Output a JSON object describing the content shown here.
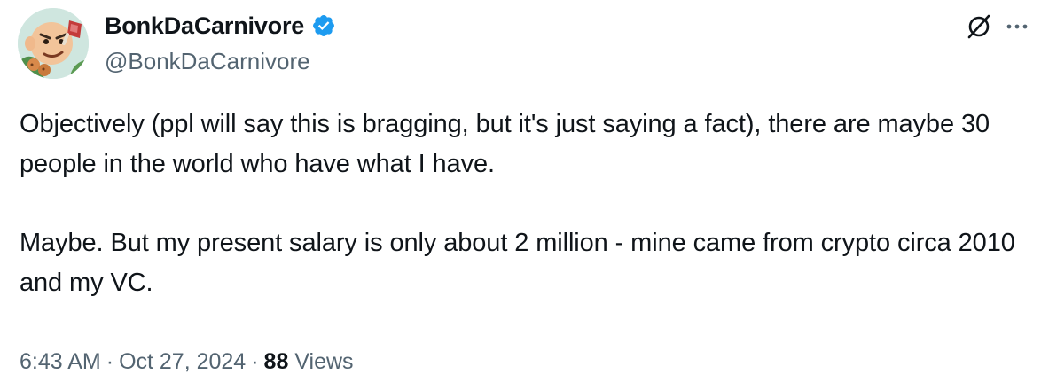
{
  "author": {
    "display_name": "BonkDaCarnivore",
    "handle": "@BonkDaCarnivore",
    "verified": true,
    "verified_color": "#1d9bf0"
  },
  "actions": {
    "grok_icon": "slashed-circle-icon",
    "more_icon": "more-dots-icon"
  },
  "tweet": {
    "paragraphs": [
      "Objectively (ppl will say this is bragging, but it's just saying a fact), there are maybe 30 people in the world who have what I have.",
      "Maybe.  But my present salary is only about 2 million - mine came from crypto circa 2010 and my VC."
    ]
  },
  "meta": {
    "time": "6:43 AM",
    "separator": "·",
    "date": "Oct 27, 2024",
    "views_count": "88",
    "views_label": "Views"
  },
  "colors": {
    "text": "#0f1419",
    "secondary": "#536471"
  }
}
